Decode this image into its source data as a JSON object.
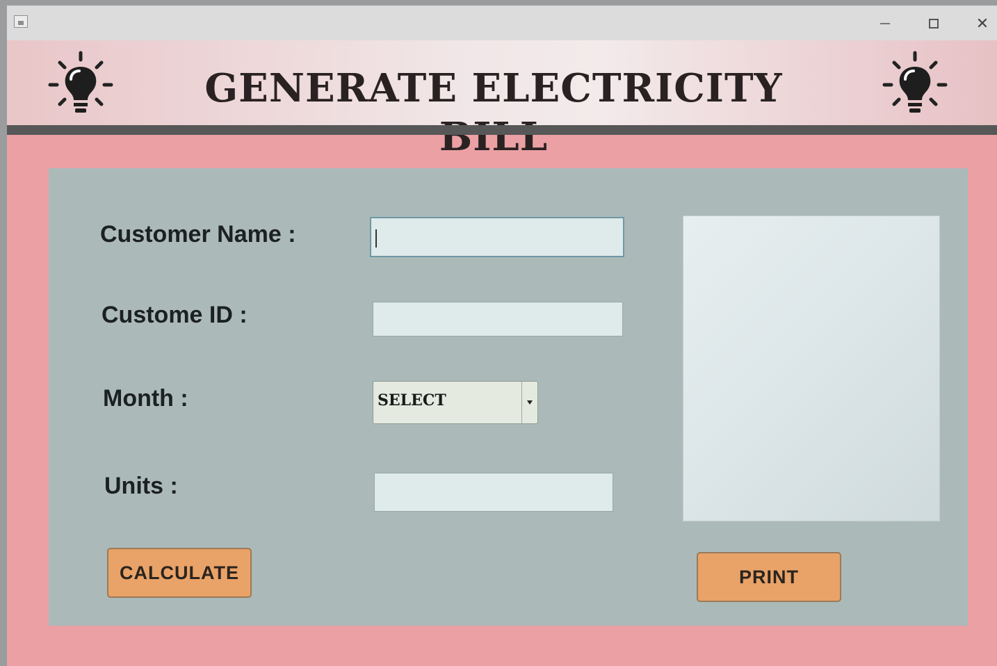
{
  "window": {
    "title": "",
    "controls": {
      "minimize": "minimize-icon",
      "maximize": "maximize-icon",
      "close": "close-icon",
      "close_glyph": "✕"
    }
  },
  "header": {
    "title": "GENERATE ELECTRICITY BILL",
    "left_icon": "lightbulb-icon",
    "right_icon": "lightbulb-icon"
  },
  "form": {
    "customer_name": {
      "label": "Customer Name :",
      "value": ""
    },
    "customer_id": {
      "label": "Custome ID :",
      "value": ""
    },
    "month": {
      "label": "Month :",
      "selected": "SELECT"
    },
    "units": {
      "label": "Units :",
      "value": ""
    }
  },
  "output": {
    "text": ""
  },
  "buttons": {
    "calculate": "CALCULATE",
    "print": "PRINT"
  },
  "colors": {
    "frame": "#eba0a4",
    "panel": "#abbab9",
    "button": "#e9a268",
    "header_rule": "#575757"
  }
}
